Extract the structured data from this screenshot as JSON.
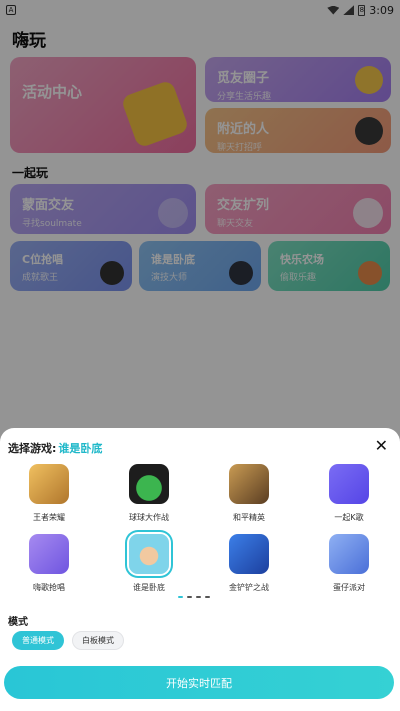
{
  "status_bar": {
    "time": "3:09"
  },
  "page": {
    "title": "嗨玩",
    "section_title": "一起玩",
    "cards": [
      {
        "title": "活动中心",
        "subtitle": ""
      },
      {
        "title": "觅友圈子",
        "subtitle": "分享生活乐趣"
      },
      {
        "title": "附近的人",
        "subtitle": "聊天打招呼"
      },
      {
        "title": "蒙面交友",
        "subtitle": "寻找soulmate"
      },
      {
        "title": "交友扩列",
        "subtitle": "聊天交友"
      },
      {
        "title": "C位抢唱",
        "subtitle": "成就歌王"
      },
      {
        "title": "谁是卧底",
        "subtitle": "演技大师"
      },
      {
        "title": "快乐农场",
        "subtitle": "偷取乐趣"
      }
    ]
  },
  "sheet": {
    "header_label": "选择游戏:",
    "selected_game": "谁是卧底",
    "games": [
      {
        "label": "王者荣耀",
        "icon": "honor-of-kings-icon",
        "color": "#d8a24a"
      },
      {
        "label": "球球大作战",
        "icon": "ball-battle-icon",
        "color": "#3db24e"
      },
      {
        "label": "和平精英",
        "icon": "peace-elite-icon",
        "color": "#8b6a3f"
      },
      {
        "label": "一起K歌",
        "icon": "karaoke-icon",
        "color": "#6b5cf0"
      },
      {
        "label": "嗨歌抢唱",
        "icon": "sing-grab-icon",
        "color": "#8f6ee8"
      },
      {
        "label": "谁是卧底",
        "icon": "undercover-icon",
        "color": "#5fc8e0"
      },
      {
        "label": "金铲铲之战",
        "icon": "golden-spatula-icon",
        "color": "#2f6fd6"
      },
      {
        "label": "蛋仔派对",
        "icon": "eggy-party-icon",
        "color": "#6a8fe8"
      }
    ],
    "mode_title": "模式",
    "modes": [
      "普通模式",
      "白板模式"
    ],
    "start_label": "开始实时匹配"
  }
}
